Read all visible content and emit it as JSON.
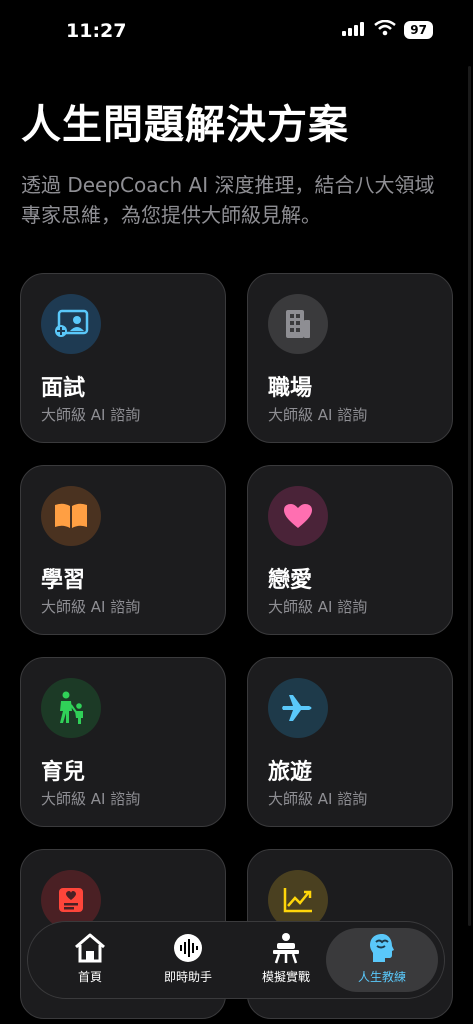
{
  "status": {
    "time": "11:27",
    "battery": "97",
    "icons": [
      "signal-icon",
      "wifi-icon",
      "battery-icon"
    ]
  },
  "header": {
    "title": "人生問題解決方案",
    "subtitle": "透過 DeepCoach AI 深度推理，結合八大領域專家思維，為您提供大師級見解。"
  },
  "categories": [
    {
      "title": "面試",
      "subtitle": "大師級 AI 諮詢",
      "icon": "interview-icon",
      "color": "#5ac8fa",
      "bg": "#1e3a52"
    },
    {
      "title": "職場",
      "subtitle": "大師級 AI 諮詢",
      "icon": "building-icon",
      "color": "#8e8e93",
      "bg": "#3a3a3c"
    },
    {
      "title": "學習",
      "subtitle": "大師級 AI 諮詢",
      "icon": "book-icon",
      "color": "#ff9f43",
      "bg": "#4a3220"
    },
    {
      "title": "戀愛",
      "subtitle": "大師級 AI 諮詢",
      "icon": "heart-icon",
      "color": "#ff6fb1",
      "bg": "#4a2338"
    },
    {
      "title": "育兒",
      "subtitle": "大師級 AI 諮詢",
      "icon": "parent-child-icon",
      "color": "#30d158",
      "bg": "#1c3a26"
    },
    {
      "title": "旅遊",
      "subtitle": "大師級 AI 諮詢",
      "icon": "airplane-icon",
      "color": "#5ac8fa",
      "bg": "#1e3a4a"
    },
    {
      "title": "",
      "subtitle": "",
      "icon": "health-card-icon",
      "color": "#ff453a",
      "bg": "#4a2024"
    },
    {
      "title": "",
      "subtitle": "",
      "icon": "chart-icon",
      "color": "#ffd60a",
      "bg": "#4a4020"
    }
  ],
  "tabs": [
    {
      "label": "首頁",
      "icon": "home-icon",
      "active": false
    },
    {
      "label": "即時助手",
      "icon": "waveform-icon",
      "active": false
    },
    {
      "label": "模擬實戰",
      "icon": "presenter-icon",
      "active": false
    },
    {
      "label": "人生教練",
      "icon": "brain-head-icon",
      "active": true
    }
  ],
  "colors": {
    "accent": "#5ac8fa",
    "card_bg": "#1c1c1e",
    "muted": "#8e8e93"
  }
}
